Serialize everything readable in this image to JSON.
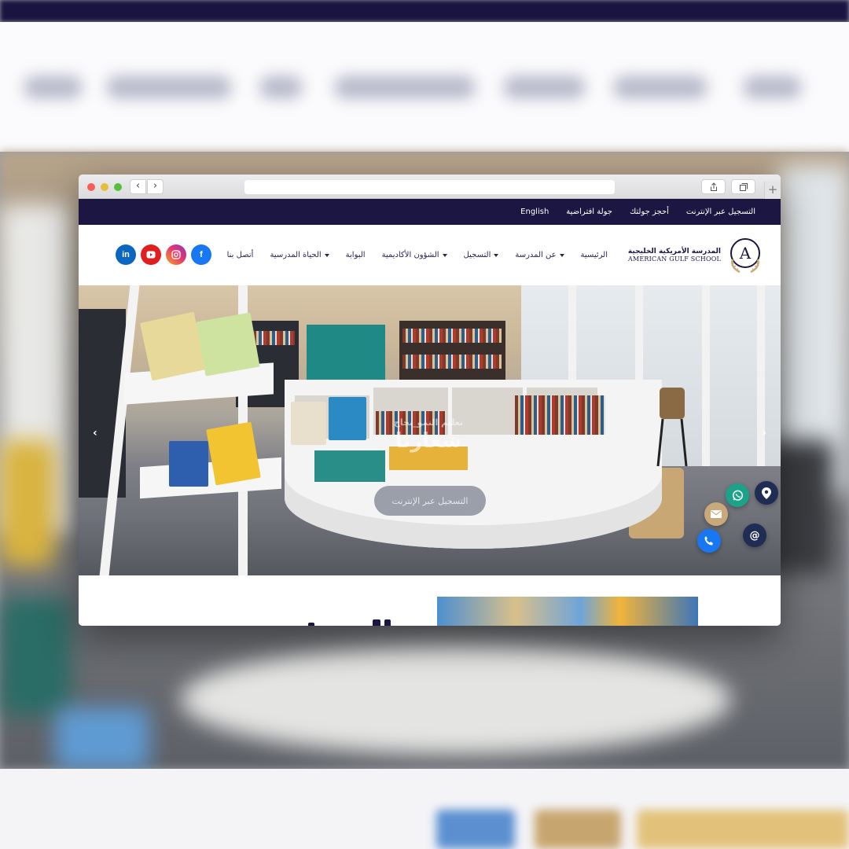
{
  "topbar": {
    "links": [
      {
        "label": "التسجيل عبر الإنترنت"
      },
      {
        "label": "أحجز جولتك"
      },
      {
        "label": "جولة افتراضية"
      },
      {
        "label": "English"
      }
    ]
  },
  "logo": {
    "letter": "A",
    "name_ar": "المدرسة الأمريكية الخليجية",
    "name_en": "AMERICAN GULF SCHOOL"
  },
  "nav": {
    "items": [
      {
        "label": "الرئيسية",
        "dropdown": false
      },
      {
        "label": "عن المدرسة",
        "dropdown": true
      },
      {
        "label": "التسجيل",
        "dropdown": true
      },
      {
        "label": "الشؤون الأكاديمية",
        "dropdown": true
      },
      {
        "label": "البوابة",
        "dropdown": false
      },
      {
        "label": "الحياة المدرسية",
        "dropdown": true
      },
      {
        "label": "أتصل بنا",
        "dropdown": false
      }
    ]
  },
  "social": {
    "icons": [
      "facebook-icon",
      "instagram-icon",
      "youtube-icon",
      "linkedin-icon"
    ],
    "facebook": "f",
    "linkedin": "in",
    "colors": {
      "facebook": "#1877f2",
      "youtube": "#e01e1e",
      "linkedin": "#0b66c2"
    }
  },
  "hero": {
    "subtitle": "تعليم النمو_نجاح",
    "title": "شعارنا",
    "cta_label": "التسجيل عبر الإنترنت",
    "prev_arrow": "‹",
    "next_arrow": "›"
  },
  "browser": {
    "back": "‹",
    "forward": "›",
    "new_tab": "+"
  },
  "floating": {
    "icons": [
      "map-pin-icon",
      "whatsapp-icon",
      "mail-icon",
      "at-icon",
      "phone-icon"
    ],
    "at_symbol": "@"
  },
  "colors": {
    "brand_navy": "#1c1642",
    "whatsapp": "#1aa38a",
    "accent_gold": "#c9a97a"
  }
}
